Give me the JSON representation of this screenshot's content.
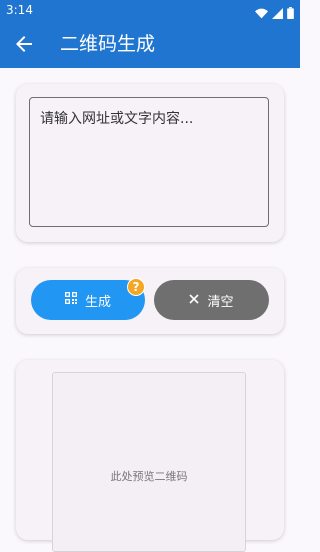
{
  "status_bar": {
    "time": "3:14"
  },
  "app_bar": {
    "title": "二维码生成"
  },
  "input": {
    "placeholder": "请输入网址或文字内容...",
    "value": ""
  },
  "actions": {
    "generate_label": "生成",
    "clear_label": "清空",
    "help_badge": "?"
  },
  "preview": {
    "placeholder_text": "此处预览二维码"
  },
  "colors": {
    "primary": "#1f75cf",
    "generate_button": "#2196f3",
    "clear_button": "#6f6f6f",
    "badge": "#f5a623",
    "background": "#fbf8fd"
  }
}
